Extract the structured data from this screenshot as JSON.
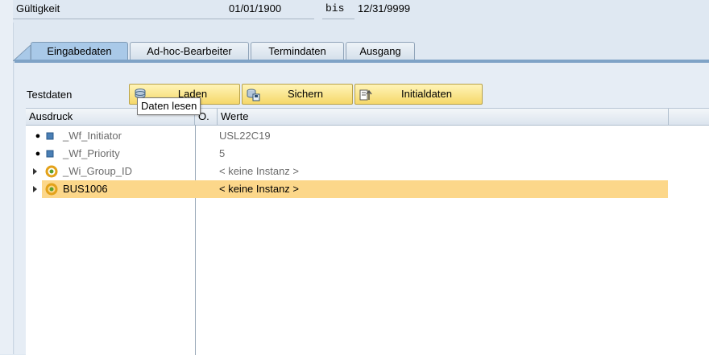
{
  "validity": {
    "label": "Gültigkeit",
    "from": "01/01/1900",
    "bis": "bis",
    "to": "12/31/9999"
  },
  "tabs": [
    {
      "label": "Eingabedaten",
      "active": true
    },
    {
      "label": "Ad-hoc-Bearbeiter",
      "active": false
    },
    {
      "label": "Termindaten",
      "active": false
    },
    {
      "label": "Ausgang",
      "active": false
    }
  ],
  "testdata": {
    "label": "Testdaten",
    "load_label": "Laden",
    "save_label": "Sichern",
    "init_label": "Initialdaten",
    "tooltip": "Daten lesen"
  },
  "tree": {
    "columns": [
      "Ausdruck",
      "O.",
      "Werte"
    ],
    "rows": [
      {
        "name": "_Wf_Initiator",
        "value": "USL22C19",
        "icon": "square-element-icon",
        "expander": "bullet",
        "dim": true
      },
      {
        "name": "_Wf_Priority",
        "value": "5",
        "icon": "square-element-icon",
        "expander": "bullet",
        "dim": true
      },
      {
        "name": "_Wi_Group_ID",
        "value": "< keine Instanz >",
        "icon": "object-ring-icon",
        "expander": "triangle",
        "dim": true
      },
      {
        "name": "BUS1006",
        "value": "< keine Instanz >",
        "icon": "object-ring-icon",
        "expander": "triangle",
        "dim": false,
        "selected": true
      }
    ]
  },
  "colors": {
    "selected_row": "#fcd78a",
    "button": "#f5d86a",
    "active_tab": "#a9c9e8"
  }
}
